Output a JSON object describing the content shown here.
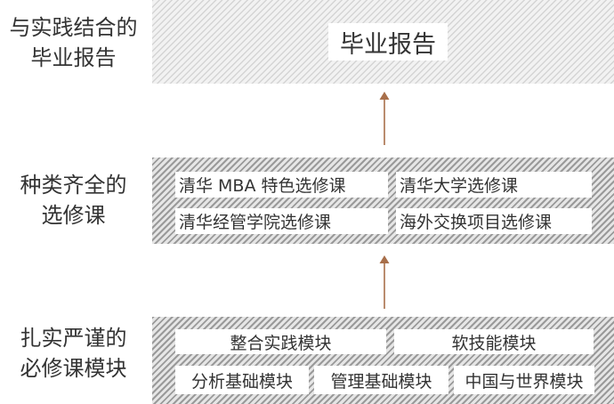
{
  "levels": {
    "top": {
      "label_line1": "与实践结合的",
      "label_line2": "毕业报告",
      "box": "毕业报告"
    },
    "middle": {
      "label_line1": "种类齐全的",
      "label_line2": "选修课",
      "boxes": [
        "清华 MBA 特色选修课",
        "清华大学选修课",
        "清华经管学院选修课",
        "海外交换项目选修课"
      ]
    },
    "bottom": {
      "label_line1": "扎实严谨的",
      "label_line2": "必修课模块",
      "boxes": [
        "整合实践模块",
        "软技能模块",
        "分析基础模块",
        "管理基础模块",
        "中国与世界模块"
      ]
    }
  },
  "colors": {
    "arrow": "#a86f4a",
    "text": "#333333"
  }
}
